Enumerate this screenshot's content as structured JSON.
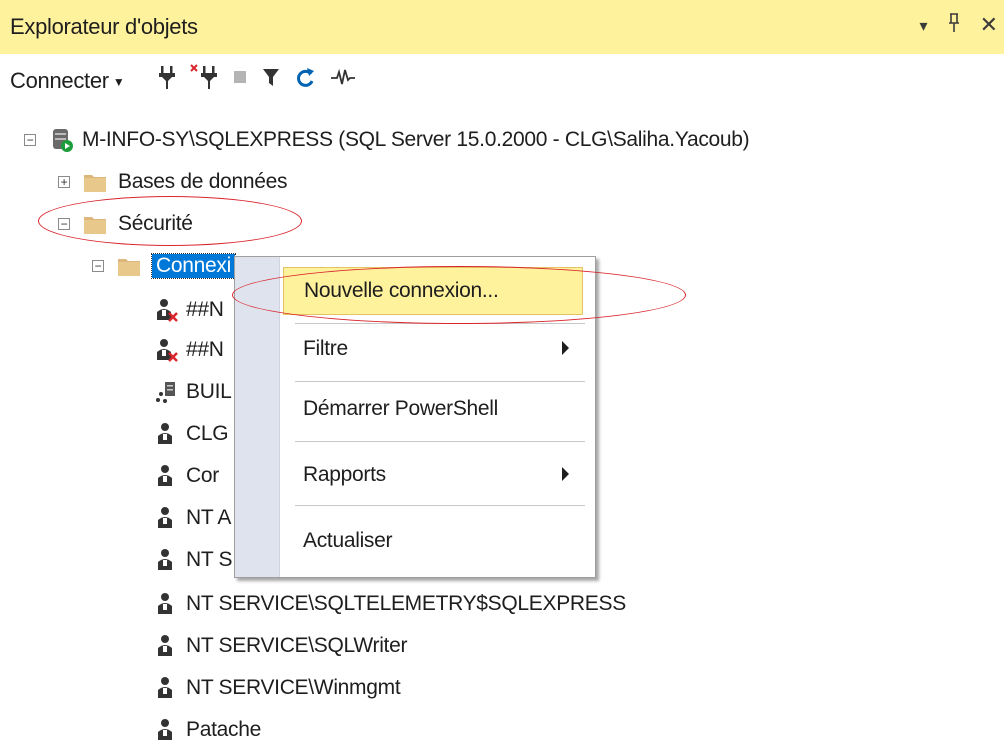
{
  "window": {
    "title": "Explorateur d'objets",
    "controls": {
      "dropdown": "▾",
      "pin": "ᵽ",
      "close": "✕"
    }
  },
  "toolbar": {
    "connect_label": "Connecter",
    "icons": [
      "connect-icon",
      "disconnect-icon",
      "stop-icon",
      "filter-icon",
      "refresh-icon",
      "activity-monitor-icon"
    ]
  },
  "tree": {
    "server": "M-INFO-SY\\SQLEXPRESS (SQL Server 15.0.2000 - CLG\\Saliha.Yacoub)",
    "databases": "Bases de données",
    "security": "Sécurité",
    "logins_folder": "Connexi",
    "logins": [
      {
        "label": "##N",
        "icon": "disabled-login-icon"
      },
      {
        "label": "##N",
        "icon": "disabled-login-icon"
      },
      {
        "label": "BUIL",
        "icon": "group-login-icon"
      },
      {
        "label": "CLG",
        "icon": "login-icon"
      },
      {
        "label": "Cor",
        "icon": "login-icon"
      },
      {
        "label": "NT A",
        "icon": "login-icon"
      },
      {
        "label": "NT S",
        "icon": "login-icon"
      },
      {
        "label": "NT SERVICE\\SQLTELEMETRY$SQLEXPRESS",
        "icon": "login-icon"
      },
      {
        "label": "NT SERVICE\\SQLWriter",
        "icon": "login-icon"
      },
      {
        "label": "NT SERVICE\\Winmgmt",
        "icon": "login-icon"
      },
      {
        "label": "Patache",
        "icon": "login-icon"
      }
    ]
  },
  "context_menu": {
    "items": [
      {
        "label": "Nouvelle connexion...",
        "submenu": false
      },
      {
        "label": "Filtre",
        "submenu": true
      },
      {
        "label": "Démarrer PowerShell",
        "submenu": false
      },
      {
        "label": "Rapports",
        "submenu": true
      },
      {
        "label": "Actualiser",
        "submenu": false
      }
    ]
  },
  "colors": {
    "title_bg": "#fff29d",
    "selection": "#0078d7",
    "menu_highlight": "#fff29d",
    "annotation": "#d9262c"
  }
}
